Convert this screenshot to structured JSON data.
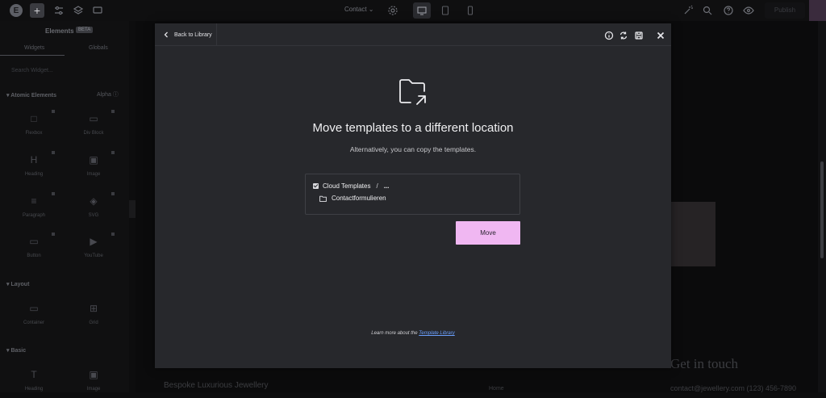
{
  "topbar": {
    "logo": "E",
    "add_label": "+",
    "page_name": "Contact ⌄",
    "publish_label": "Publish"
  },
  "panel": {
    "title": "Elements",
    "badge": "BETA",
    "tabs": [
      "Widgets",
      "Globals"
    ],
    "search_placeholder": "Search Widget...",
    "sections": {
      "atomic": "Atomic Elements",
      "alpha": "Alpha ⓘ",
      "layout": "Layout",
      "basic": "Basic"
    },
    "atomic_widgets": [
      {
        "label": "Flexbox",
        "icon": "□"
      },
      {
        "label": "Div Block",
        "icon": "▭"
      },
      {
        "label": "Heading",
        "icon": "H"
      },
      {
        "label": "Image",
        "icon": "▣"
      },
      {
        "label": "Paragraph",
        "icon": "≡"
      },
      {
        "label": "SVG",
        "icon": "◈"
      },
      {
        "label": "Button",
        "icon": "▭"
      },
      {
        "label": "YouTube",
        "icon": "▶"
      }
    ],
    "layout_widgets": [
      {
        "label": "Container",
        "icon": "▭"
      },
      {
        "label": "Grid",
        "icon": "⊞"
      }
    ],
    "basic_widgets": [
      {
        "label": "Heading",
        "icon": "T"
      },
      {
        "label": "Image",
        "icon": "▣"
      }
    ]
  },
  "canvas": {
    "get_in_touch": "Get in touch",
    "footer_brand": "Bespoke Luxurious Jewellery",
    "contact_line": "contact@jewellery.com  (123) 456-7890",
    "small_label": "Home"
  },
  "modal": {
    "back_label": "Back to Library",
    "title": "Move templates to a different location",
    "subtitle": "Alternatively, you can copy the templates.",
    "location": {
      "root": "Cloud Templates",
      "separator": "/",
      "more": "...",
      "folder": "Contactformulieren"
    },
    "move_label": "Move",
    "learn_prefix": "Learn more about the ",
    "learn_link": "Template Library"
  },
  "colors": {
    "accent": "#f0b7f2",
    "modal_bg": "#27282c",
    "link": "#6aa0ff"
  }
}
